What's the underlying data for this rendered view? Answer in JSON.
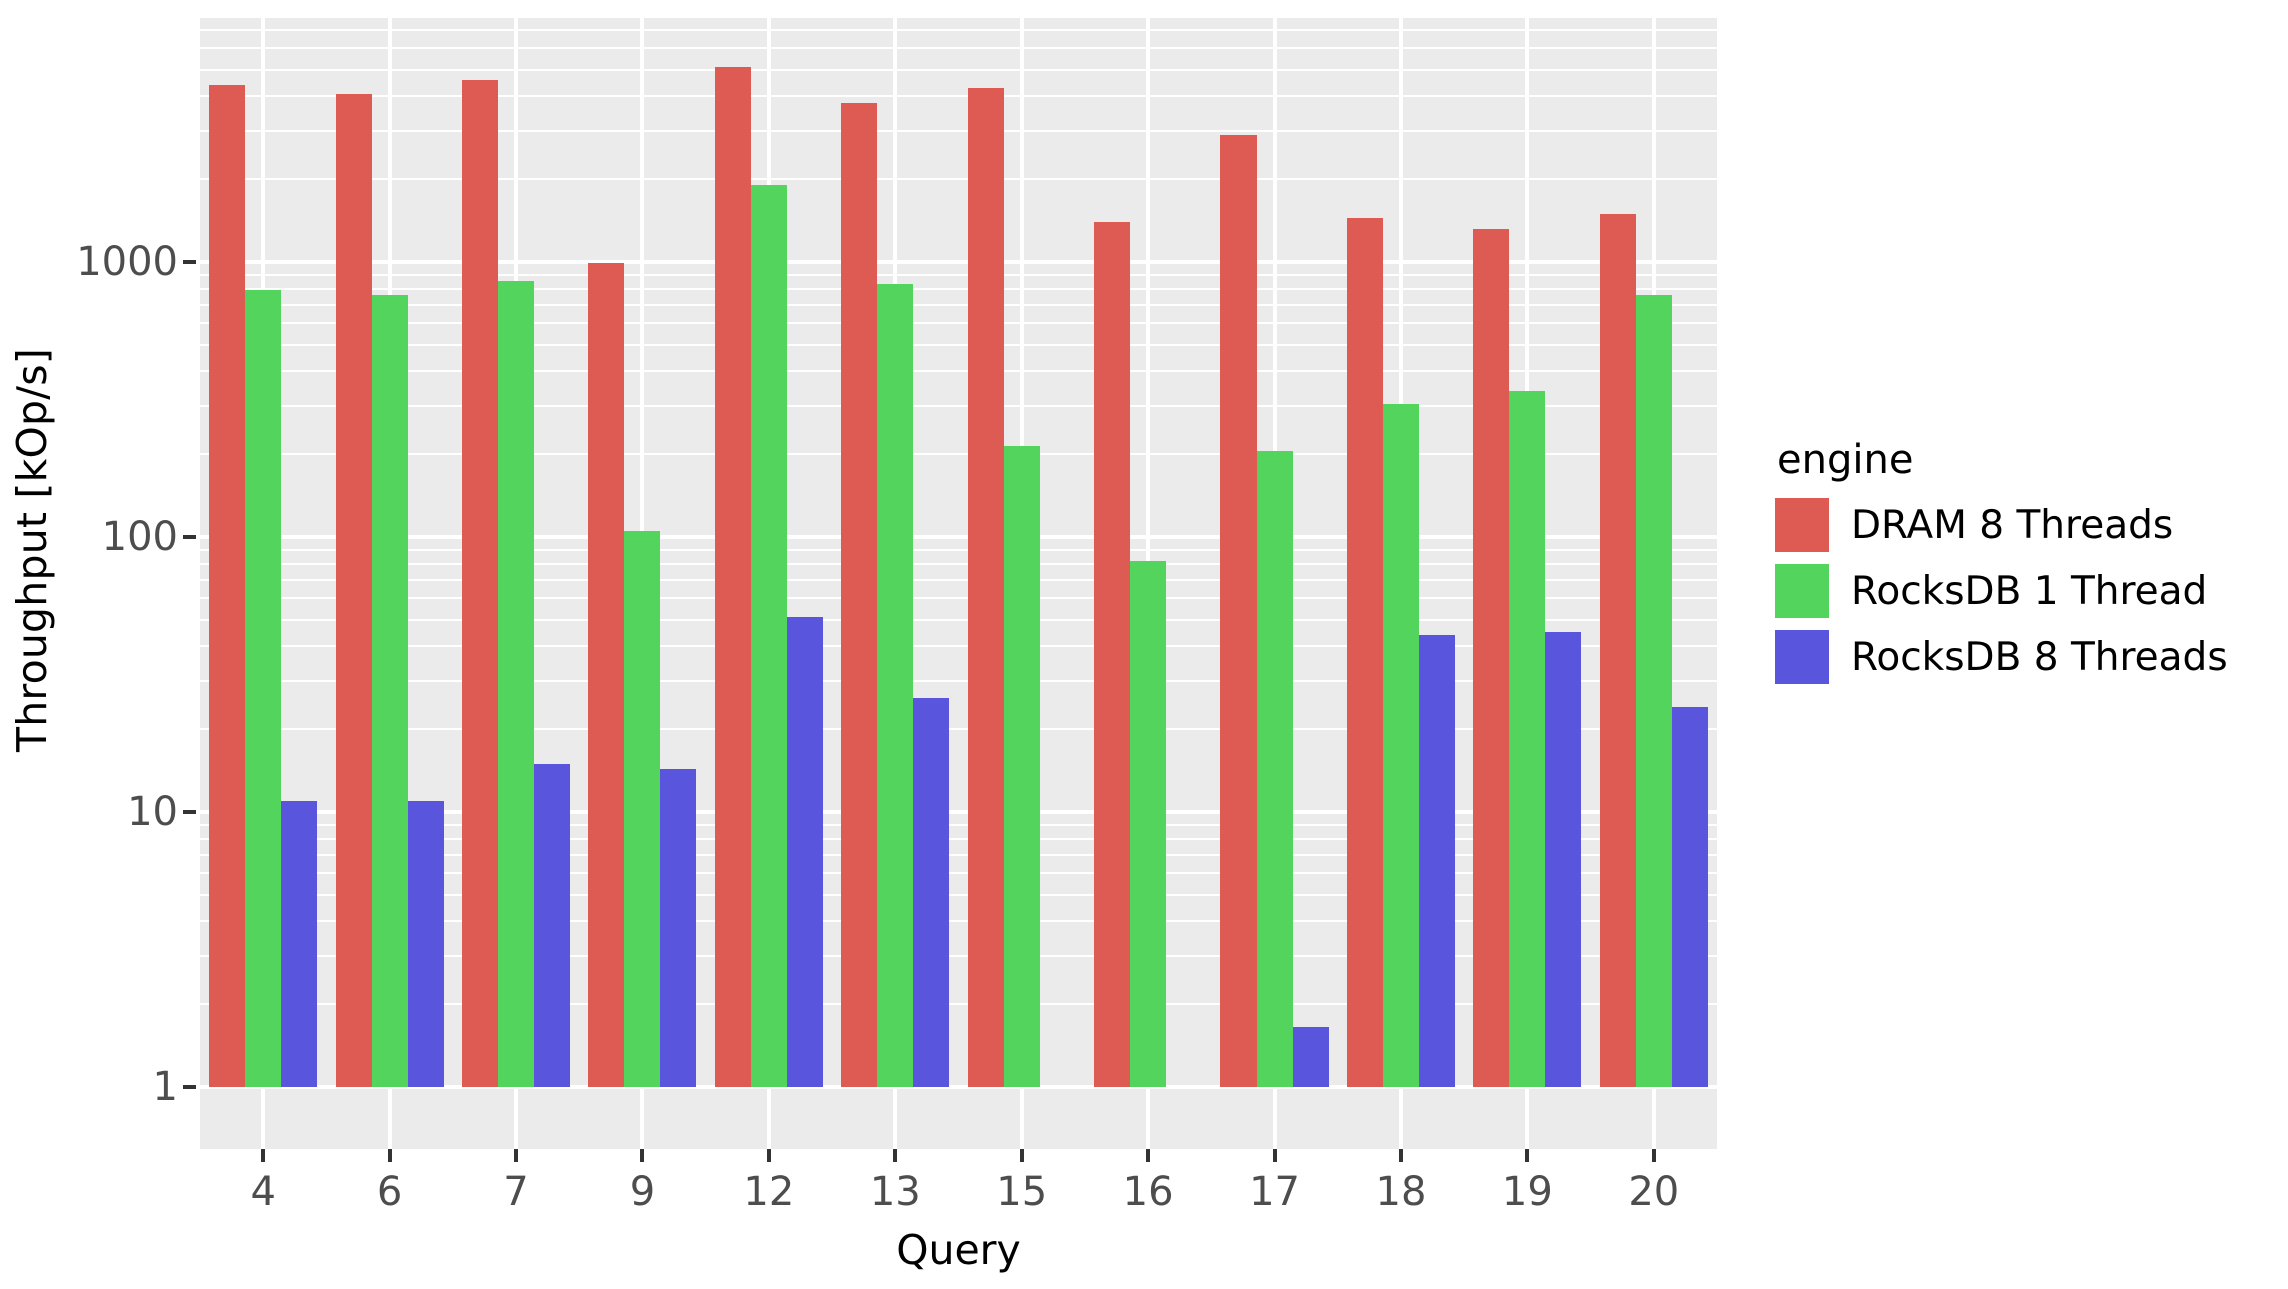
{
  "chart_data": {
    "type": "bar",
    "title": "",
    "subtitle": "",
    "xlabel": "Query",
    "ylabel": "Throughput [kOp/s]",
    "yscale": "log10",
    "ylim": [
      1,
      6500
    ],
    "ytick_labels": [
      "1000",
      "100",
      "10",
      "1"
    ],
    "ytick_values": [
      1000,
      100,
      10,
      1
    ],
    "grid": true,
    "legend_position": "right",
    "legend_title": "engine",
    "categories": [
      "4",
      "6",
      "7",
      "9",
      "12",
      "13",
      "15",
      "16",
      "17",
      "18",
      "19",
      "20"
    ],
    "series": [
      {
        "name": "DRAM 8 Threads",
        "color": "#dd5b53",
        "values": [
          4400,
          4100,
          4600,
          990,
          5100,
          3800,
          4300,
          1400,
          2900,
          1450,
          1320,
          1500
        ]
      },
      {
        "name": "RocksDB 1 Thread",
        "color": "#53d45c",
        "values": [
          790,
          760,
          850,
          105,
          1900,
          830,
          215,
          82,
          205,
          305,
          340,
          760
        ]
      },
      {
        "name": "RocksDB 8 Threads",
        "color": "#5a55dd",
        "values": [
          11,
          11,
          15,
          14.3,
          51,
          26,
          null,
          null,
          1.65,
          44,
          45,
          24
        ]
      }
    ]
  },
  "legend": {
    "title": "engine",
    "entries": [
      {
        "label": "DRAM 8 Threads",
        "color": "#dd5b53"
      },
      {
        "label": "RocksDB 1 Thread",
        "color": "#53d45c"
      },
      {
        "label": "RocksDB 8 Threads",
        "color": "#5a55dd"
      }
    ]
  },
  "axes": {
    "x_title": "Query",
    "y_title": "Throughput [kOp/s]",
    "x_tick_labels": [
      "4",
      "6",
      "7",
      "9",
      "12",
      "13",
      "15",
      "16",
      "17",
      "18",
      "19",
      "20"
    ],
    "y_tick_labels": [
      "1000",
      "100",
      "10",
      "1"
    ]
  },
  "theme": {
    "panel_background": "#ebebeb",
    "grid_color": "#ffffff",
    "text_color": "#4d4d4d",
    "title_color": "#000000"
  }
}
